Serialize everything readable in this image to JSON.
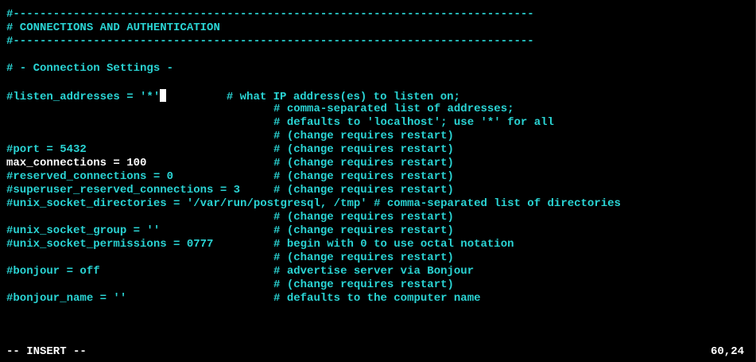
{
  "editor": {
    "lines": [
      {
        "text": "#------------------------------------------------------------------------------",
        "style": "comment"
      },
      {
        "text": "# CONNECTIONS AND AUTHENTICATION",
        "style": "comment"
      },
      {
        "text": "#------------------------------------------------------------------------------",
        "style": "comment"
      },
      {
        "text": "",
        "style": "comment"
      },
      {
        "text": "# - Connection Settings -",
        "style": "comment"
      },
      {
        "text": "",
        "style": "comment"
      },
      {
        "text": "#listen_addresses = '*'",
        "style": "comment",
        "cursor": true,
        "after": "         # what IP address(es) to listen on;"
      },
      {
        "text": "                                        # comma-separated list of addresses;",
        "style": "comment"
      },
      {
        "text": "                                        # defaults to 'localhost'; use '*' for all",
        "style": "comment"
      },
      {
        "text": "                                        # (change requires restart)",
        "style": "comment"
      },
      {
        "text": "#port = 5432                            # (change requires restart)",
        "style": "comment"
      },
      {
        "text": "max_connections = 100",
        "style": "plain",
        "after": "                   # (change requires restart)"
      },
      {
        "text": "#reserved_connections = 0               # (change requires restart)",
        "style": "comment"
      },
      {
        "text": "#superuser_reserved_connections = 3     # (change requires restart)",
        "style": "comment"
      },
      {
        "text": "#unix_socket_directories = '/var/run/postgresql, /tmp' # comma-separated list of directories",
        "style": "comment"
      },
      {
        "text": "                                        # (change requires restart)",
        "style": "comment"
      },
      {
        "text": "#unix_socket_group = ''                 # (change requires restart)",
        "style": "comment"
      },
      {
        "text": "#unix_socket_permissions = 0777         # begin with 0 to use octal notation",
        "style": "comment"
      },
      {
        "text": "                                        # (change requires restart)",
        "style": "comment"
      },
      {
        "text": "#bonjour = off                          # advertise server via Bonjour",
        "style": "comment"
      },
      {
        "text": "                                        # (change requires restart)",
        "style": "comment"
      },
      {
        "text": "#bonjour_name = ''                      # defaults to the computer name",
        "style": "comment"
      }
    ]
  },
  "status": {
    "mode": "-- INSERT --",
    "position": "60,24"
  },
  "colors": {
    "background": "#000000",
    "comment": "#2ad4d4",
    "plain": "#ffffff"
  }
}
